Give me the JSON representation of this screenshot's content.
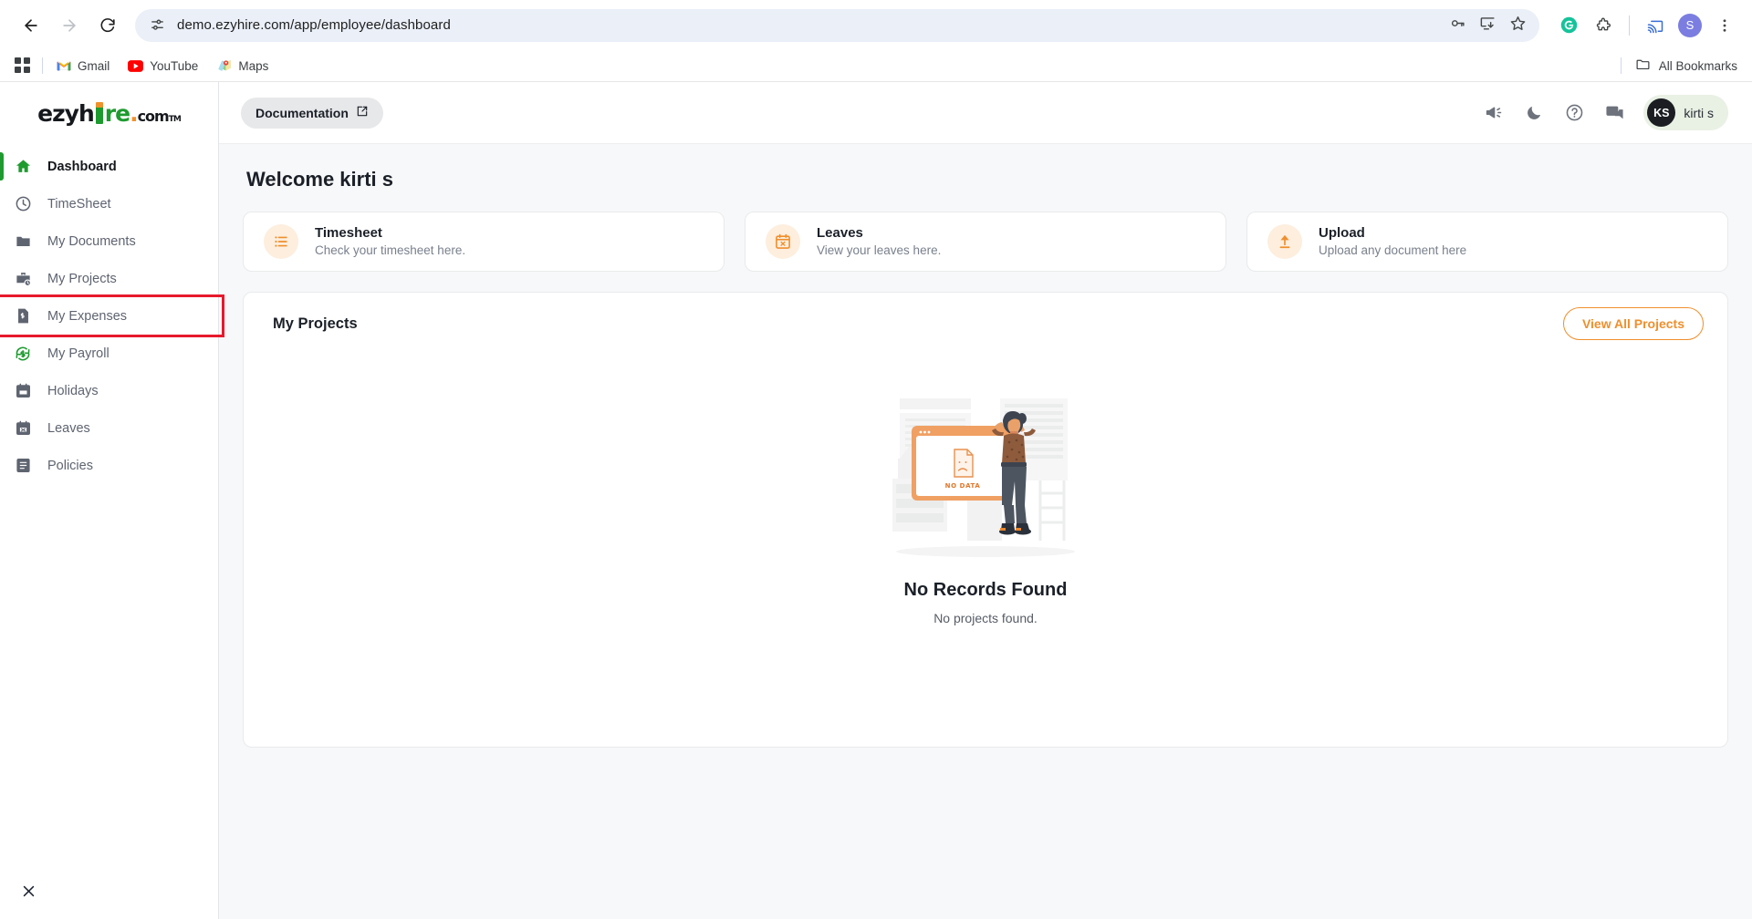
{
  "browser": {
    "url": "demo.ezyhire.com/app/employee/dashboard",
    "back_label": "Back",
    "forward_label": "Forward",
    "reload_label": "Reload",
    "site_info_label": "View site information",
    "save_passwords_label": "Passwords",
    "install_label": "Install",
    "bookmark_label": "Bookmark this tab",
    "grammarly_label": "Grammarly",
    "extensions_label": "Extensions",
    "cast_label": "Cast",
    "menu_label": "Customize and control Google Chrome",
    "profile_initial": "S",
    "bookmarks": [
      {
        "label": "Gmail",
        "icon": "gmail-icon"
      },
      {
        "label": "YouTube",
        "icon": "youtube-icon"
      },
      {
        "label": "Maps",
        "icon": "maps-icon"
      }
    ],
    "all_bookmarks_label": "All Bookmarks",
    "apps_label": "Apps"
  },
  "brand": {
    "name_part1": "ezyh",
    "name_part2": "re",
    "dot": ".",
    "com": "com",
    "tm": "TM"
  },
  "sidebar": {
    "items": [
      {
        "label": "Dashboard",
        "icon": "home-icon",
        "active": true,
        "highlight": false
      },
      {
        "label": "TimeSheet",
        "icon": "clock-icon",
        "active": false,
        "highlight": false
      },
      {
        "label": "My Documents",
        "icon": "folder-icon",
        "active": false,
        "highlight": false
      },
      {
        "label": "My Projects",
        "icon": "briefcase-icon",
        "active": false,
        "highlight": false
      },
      {
        "label": "My Expenses",
        "icon": "receipt-icon",
        "active": false,
        "highlight": true
      },
      {
        "label": "My Payroll",
        "icon": "money-icon",
        "active": false,
        "highlight": false
      },
      {
        "label": "Holidays",
        "icon": "calendar-icon",
        "active": false,
        "highlight": false
      },
      {
        "label": "Leaves",
        "icon": "calendar-x-icon",
        "active": false,
        "highlight": false
      },
      {
        "label": "Policies",
        "icon": "document-icon",
        "active": false,
        "highlight": false
      }
    ],
    "close_label": "Close",
    "highlight_color": "#e8192c",
    "active_color": "#1e9b2f"
  },
  "topbar": {
    "documentation_label": "Documentation",
    "announcement_label": "Announcements",
    "dark_mode_label": "Dark mode",
    "help_label": "Help",
    "chat_label": "Chat",
    "user_initials": "KS",
    "user_name": "kirti s"
  },
  "main": {
    "welcome": "Welcome kirti s",
    "cards": [
      {
        "title": "Timesheet",
        "subtitle": "Check your timesheet here.",
        "icon": "list-icon"
      },
      {
        "title": "Leaves",
        "subtitle": "View your leaves here.",
        "icon": "calendar-x-icon"
      },
      {
        "title": "Upload",
        "subtitle": "Upload any document here",
        "icon": "upload-icon"
      }
    ],
    "projects_panel": {
      "title": "My Projects",
      "view_all_label": "View All Projects",
      "empty_title": "No Records Found",
      "empty_subtitle": "No projects found.",
      "illustration_label": "NO DATA"
    }
  },
  "colors": {
    "accent_orange": "#ef8f2c",
    "brand_green": "#1e9b2f",
    "highlight_red": "#e8192c"
  }
}
